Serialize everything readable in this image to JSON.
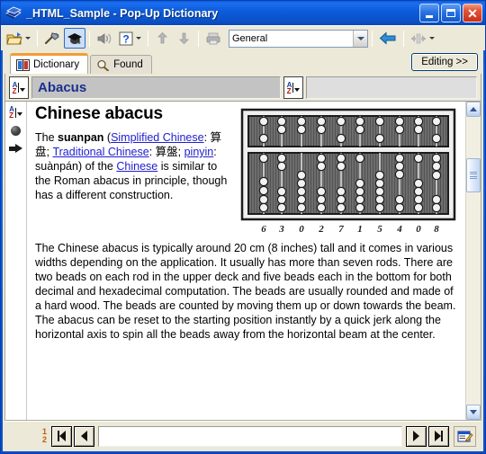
{
  "window": {
    "title": "_HTML_Sample - Pop-Up Dictionary",
    "app_icon": "books-stack-icon",
    "caption_buttons": [
      {
        "name": "minimize",
        "label": "_"
      },
      {
        "name": "maximize",
        "label": "□"
      },
      {
        "name": "close",
        "label": "✕"
      }
    ]
  },
  "toolbar": {
    "buttons": [
      {
        "name": "open-folder",
        "icon": "open-folder-icon",
        "dropdown": true,
        "enabled": true,
        "pressed": false
      },
      {
        "name": "tools-hammer",
        "icon": "hammer-icon",
        "dropdown": false,
        "enabled": true,
        "pressed": false
      },
      {
        "name": "graduation-cap",
        "icon": "graduation-cap-icon",
        "dropdown": false,
        "enabled": true,
        "pressed": true
      },
      {
        "name": "sound",
        "icon": "speaker-icon",
        "dropdown": false,
        "enabled": false,
        "pressed": false
      },
      {
        "name": "help",
        "icon": "question-mark-icon",
        "dropdown": true,
        "enabled": true,
        "pressed": false
      },
      {
        "name": "move-up",
        "icon": "arrow-up-icon",
        "dropdown": false,
        "enabled": false,
        "pressed": false
      },
      {
        "name": "move-down",
        "icon": "arrow-down-icon",
        "dropdown": false,
        "enabled": false,
        "pressed": false
      },
      {
        "name": "print",
        "icon": "printer-icon",
        "dropdown": false,
        "enabled": false,
        "pressed": false
      },
      {
        "name": "back",
        "icon": "back-arrow-icon",
        "dropdown": false,
        "enabled": true,
        "pressed": false
      },
      {
        "name": "fit-width",
        "icon": "fit-width-icon",
        "dropdown": true,
        "enabled": false,
        "pressed": false
      }
    ],
    "category_combo": {
      "value": "General",
      "placeholder": "General"
    }
  },
  "tabs": [
    {
      "label": "Dictionary",
      "icon": "book-icon",
      "active": true
    },
    {
      "label": "Found",
      "icon": "magnifier-icon",
      "active": false
    }
  ],
  "editing_button": {
    "label": "Editing >>"
  },
  "headword_bar": {
    "sort_icon": "sort-az-icon",
    "primary_value": "Abacus",
    "secondary_value": "",
    "secondary_placeholder": ""
  },
  "gutter_icons": [
    {
      "name": "sort-az-icon"
    },
    {
      "name": "sphere-bullet-icon"
    },
    {
      "name": "arrow-right-icon"
    }
  ],
  "article": {
    "title": "Chinese abacus",
    "paragraph1": {
      "pre": "The ",
      "bold_term": "suanpan",
      "after_term": " (",
      "link1": "Simplified Chinese",
      "text1": ": 算盘; ",
      "link2": "Traditional Chinese",
      "text2": ": 算盤; ",
      "link3": "pinyin",
      "text3": ": suànpán) of the ",
      "link4": "Chinese",
      "text4": " is similar to the Roman abacus in principle, though has a different construction."
    },
    "paragraph2": "The Chinese abacus is typically around 20 cm (8 inches) tall and it comes in various widths depending on the application. It usually has more than seven rods. There are two beads on each rod in the upper deck and five beads each in the bottom for both decimal and hexadecimal computation. The beads are usually rounded and made of a hard wood. The beads are counted by moving them up or down towards the beam. The abacus can be reset to the starting position instantly by a quick jerk along the horizontal axis to spin all the beads away from the horizontal beam at the center.",
    "figure": {
      "alt": "Engraving of a Chinese suanpan abacus showing a value",
      "digit_labels": [
        "6",
        "3",
        "0",
        "2",
        "7",
        "1",
        "5",
        "4",
        "0",
        "8"
      ]
    }
  },
  "scrollbar": {
    "up_icon": "chevron-up-icon",
    "down_icon": "chevron-down-icon",
    "thumb_icon": "scroll-thumb-grip"
  },
  "statusbar": {
    "page_current": "1",
    "page_total": "2",
    "first_button": "first-record-icon",
    "prev_button": "previous-record-icon",
    "next_button": "next-record-icon",
    "last_button": "last-record-icon",
    "search_value": "",
    "search_placeholder": "",
    "edit_button": "edit-entry-icon"
  },
  "colors": {
    "titlebar_blue": "#0d5ddc",
    "window_border": "#0046d5",
    "face": "#ece9d8",
    "active_tab_accent": "#f19d38",
    "headword_text": "#1a2f8f",
    "link": "#2020d0",
    "page_counter": "#c05a12"
  }
}
